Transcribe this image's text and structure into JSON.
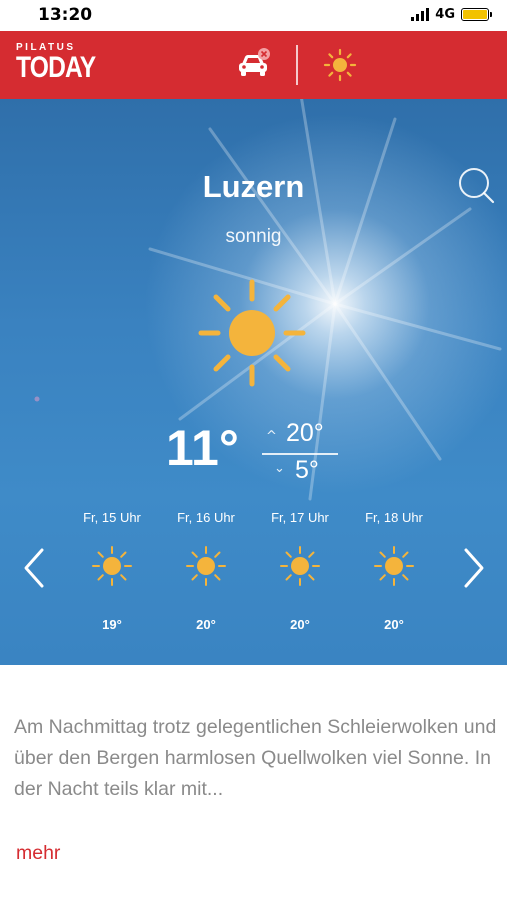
{
  "status_bar": {
    "time": "13:20",
    "network": "4G",
    "battery_color": "#f2c200"
  },
  "app_bar": {
    "logo_small": "PILATUS",
    "logo_big": "TODAY",
    "background": "#d52c31",
    "traffic_icon": "car-icon",
    "weather_icon": "sun-icon"
  },
  "weather": {
    "city": "Luzern",
    "condition": "sonnig",
    "current_temp": "11°",
    "high": "20°",
    "low": "5°",
    "icon": "sun-icon",
    "sun_color": "#f4b43c"
  },
  "forecast": [
    {
      "time": "Fr, 15 Uhr",
      "temp": "19°",
      "icon": "sun-icon"
    },
    {
      "time": "Fr, 16 Uhr",
      "temp": "20°",
      "icon": "sun-icon"
    },
    {
      "time": "Fr, 17 Uhr",
      "temp": "20°",
      "icon": "sun-icon"
    },
    {
      "time": "Fr, 18 Uhr",
      "temp": "20°",
      "icon": "sun-icon"
    }
  ],
  "description": {
    "text": "Am Nachmittag trotz gelegentlichen Schleierwolken und über den Bergen harmlosen Quellwolken viel Sonne. In der Nacht teils klar mit...",
    "more_label": "mehr"
  }
}
